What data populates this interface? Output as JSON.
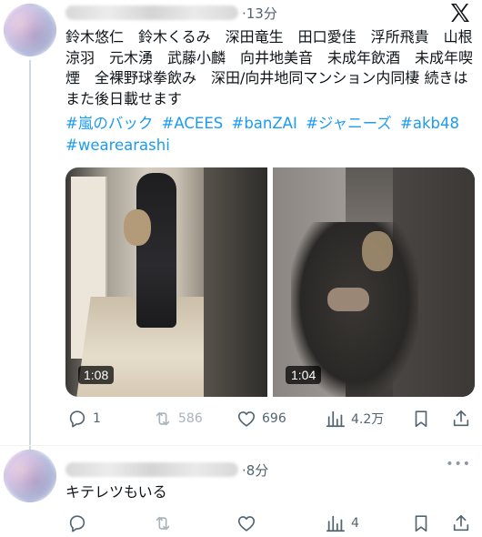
{
  "posts": [
    {
      "time": "·13分",
      "text": "鈴木悠仁　鈴木くるみ　深田竜生　田口愛佳　浮所飛貴　山根涼羽　元木湧　武藤小麟　向井地美音　未成年飲酒　未成年喫煙　全裸野球拳飲み　深田/向井地同マンション内同棲 続きはまた後日載せます",
      "hashtags": [
        "#嵐のバック",
        "#ACEES",
        "#banZAI",
        "#ジャニーズ",
        "#akb48",
        "#wearearashi"
      ],
      "videos": [
        {
          "duration": "1:08"
        },
        {
          "duration": "1:04"
        }
      ],
      "actions": {
        "reply": "1",
        "retweet": "586",
        "like": "696",
        "views": "4.2万"
      }
    },
    {
      "time": "·8分",
      "text": "キテレツもいる",
      "actions": {
        "reply": "",
        "retweet": "",
        "like": "",
        "views": "4"
      }
    }
  ],
  "icons": {
    "logo": "x-logo-icon",
    "more": "more-icon",
    "reply": "reply-icon",
    "retweet": "retweet-icon",
    "like": "heart-icon",
    "views": "views-icon",
    "bookmark": "bookmark-icon",
    "share": "share-icon"
  },
  "colors": {
    "text": "#0f1419",
    "secondary": "#536471",
    "link": "#1d9bf0",
    "muted": "#a8b3bb"
  }
}
